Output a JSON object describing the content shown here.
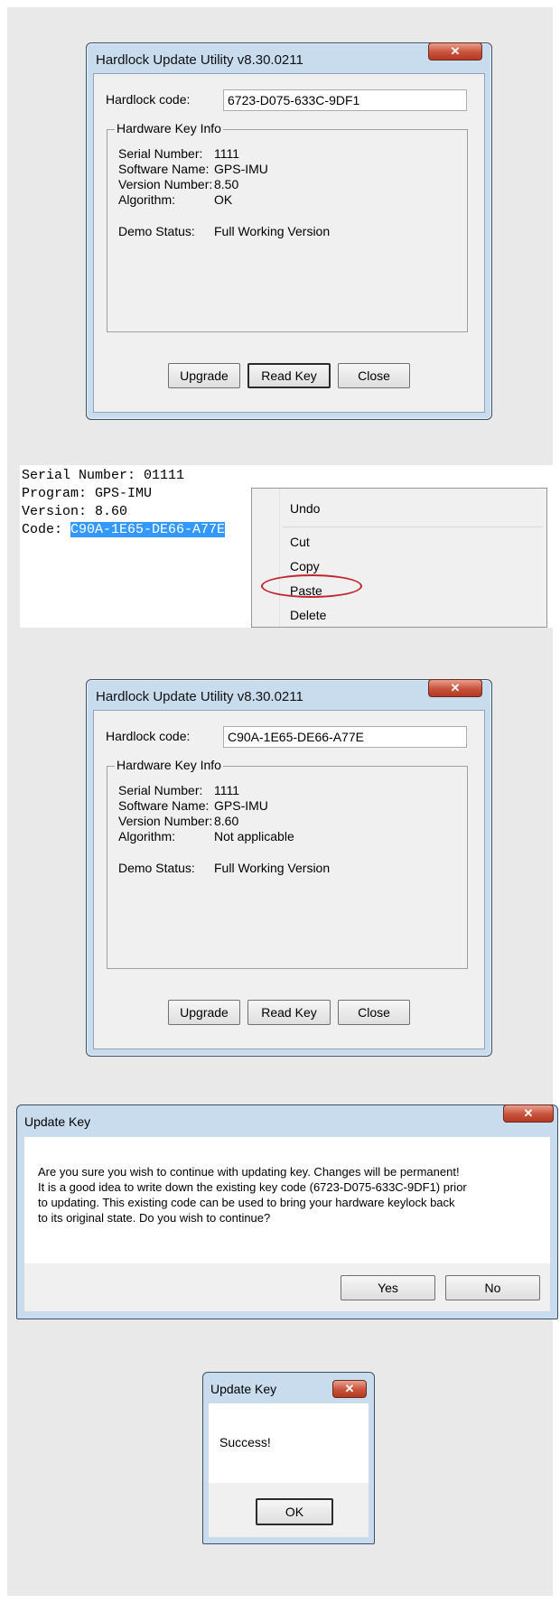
{
  "dialog1": {
    "title": "Hardlock Update Utility v8.30.0211",
    "close_glyph": "✕",
    "code_label": "Hardlock code:",
    "code_value": "6723-D075-633C-9DF1",
    "group_title": "Hardware Key Info",
    "info": {
      "serial_label": "Serial Number:",
      "serial_value": "1111",
      "software_label": "Software Name:",
      "software_value": "GPS-IMU",
      "version_label": "Version Number:",
      "version_value": "8.50",
      "algorithm_label": "Algorithm:",
      "algorithm_value": "OK",
      "demo_label": "Demo Status:",
      "demo_value": "Full Working Version"
    },
    "buttons": {
      "upgrade": "Upgrade",
      "read_key": "Read Key",
      "close": "Close"
    }
  },
  "textpanel": {
    "line1": "Serial Number: 01111",
    "line2": "Program: GPS-IMU",
    "line3": "Version: 8.60",
    "line4_prefix": "Code: ",
    "line4_selected": "C90A-1E65-DE66-A77E"
  },
  "context_menu": {
    "items": [
      "Undo",
      "Cut",
      "Copy",
      "Paste",
      "Delete"
    ]
  },
  "dialog2": {
    "title": "Hardlock Update Utility v8.30.0211",
    "close_glyph": "✕",
    "code_label": "Hardlock code:",
    "code_value": "C90A-1E65-DE66-A77E",
    "group_title": "Hardware Key Info",
    "info": {
      "serial_label": "Serial Number:",
      "serial_value": "1111",
      "software_label": "Software Name:",
      "software_value": "GPS-IMU",
      "version_label": "Version Number:",
      "version_value": "8.60",
      "algorithm_label": "Algorithm:",
      "algorithm_value": "Not applicable",
      "demo_label": "Demo Status:",
      "demo_value": "Full Working Version"
    },
    "buttons": {
      "upgrade": "Upgrade",
      "read_key": "Read Key",
      "close": "Close"
    }
  },
  "confirm": {
    "title": "Update Key",
    "close_glyph": "✕",
    "message_lines": [
      "Are you sure you wish to continue with updating key. Changes will be permanent!",
      "It is a good idea to write down the existing key code (6723-D075-633C-9DF1) prior",
      "to updating.  This existing code can be used to bring your hardware keylock back",
      "to its original state. Do you wish to continue?"
    ],
    "yes": "Yes",
    "no": "No"
  },
  "success": {
    "title": "Update Key",
    "close_glyph": "✕",
    "message": "Success!",
    "ok": "OK"
  }
}
